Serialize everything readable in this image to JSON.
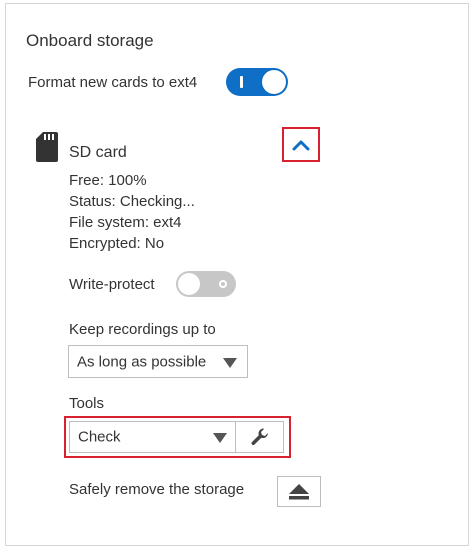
{
  "section_title": "Onboard storage",
  "format_toggle": {
    "label": "Format new cards to ext4",
    "state": "on"
  },
  "sd_card": {
    "title": "SD card",
    "details": {
      "free": "Free: 100%",
      "status": "Status: Checking...",
      "file_system": "File system: ext4",
      "encrypted": "Encrypted: No"
    },
    "write_protect": {
      "label": "Write-protect",
      "state": "off"
    },
    "keep_recordings": {
      "label": "Keep recordings up to",
      "selected": "As long as possible"
    },
    "tools": {
      "label": "Tools",
      "selected": "Check"
    },
    "safely_remove": {
      "label": "Safely remove the storage"
    }
  },
  "icons": {
    "sd": "sd-card-icon",
    "collapse": "chevron-up-icon",
    "dropdown": "triangle-down-icon",
    "wrench": "wrench-icon",
    "eject": "eject-icon"
  },
  "colors": {
    "accent": "#0f6fc6",
    "highlight": "#d9202f",
    "toggle_off": "#c7c7c7",
    "text": "#333333"
  }
}
